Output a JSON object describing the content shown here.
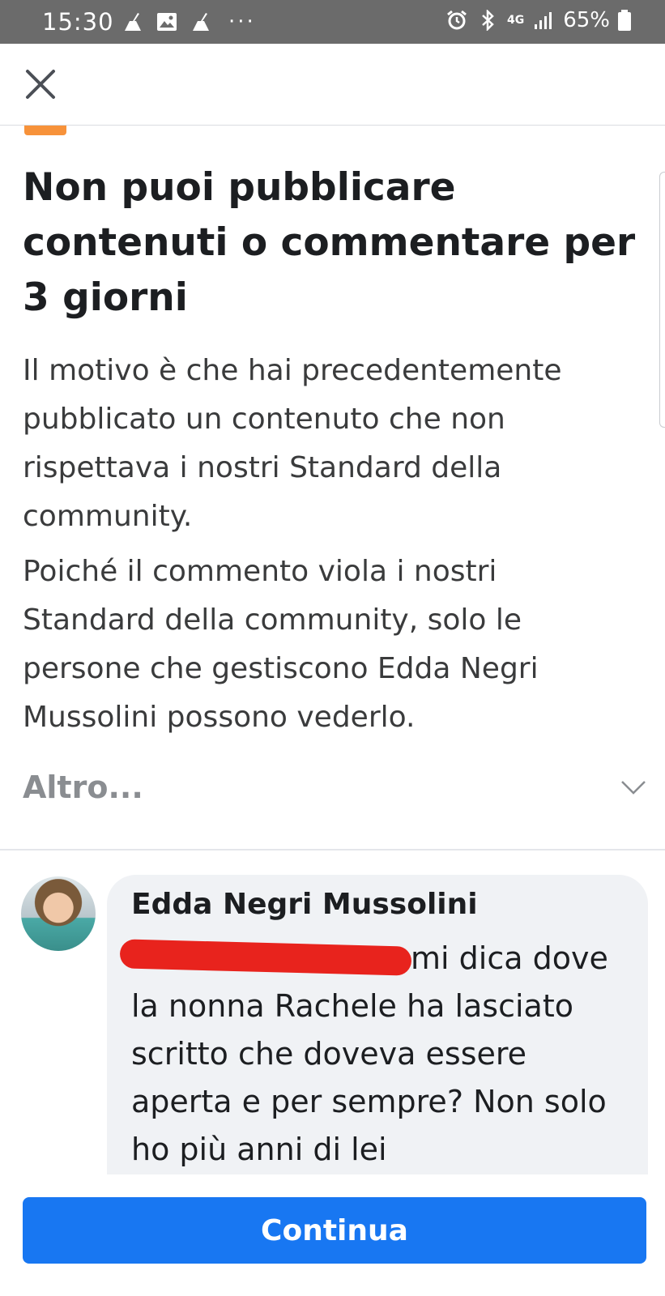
{
  "status_bar": {
    "time": "15:30",
    "left_icons": [
      "broom-icon",
      "image-icon",
      "broom-icon"
    ],
    "overflow": "···",
    "right_icons": [
      "alarm-icon",
      "bluetooth-icon",
      "signal-4g-icon",
      "signal-bars-icon"
    ],
    "network": "4G",
    "battery_percent": "65%"
  },
  "header": {
    "close_icon": "close-icon"
  },
  "notice": {
    "title": "Non puoi pubblicare contenuti o commentare per 3 giorni",
    "paragraph_1": "Il motivo è che hai precedentemente pubblicato un contenuto che non rispettava i nostri Standard della community.",
    "paragraph_2": "Poiché il commento viola i nostri Standard della community, solo le persone che gestiscono Edda Negri Mussolini possono vederlo.",
    "more_label": "Altro...",
    "more_icon": "chevron-down-icon"
  },
  "comment": {
    "author": "Edda Negri Mussolini",
    "text": "mi dica dove la nonna Rachele ha lasciato scritto che doveva essere aperta e per sempre? Non solo ho più anni di lei"
  },
  "actions": {
    "continue_label": "Continua"
  },
  "colors": {
    "status_bar": "#6b6b6b",
    "primary_button": "#1877f2",
    "warning": "#f7923a",
    "redaction": "#e8231d",
    "bubble": "#f0f2f5"
  }
}
